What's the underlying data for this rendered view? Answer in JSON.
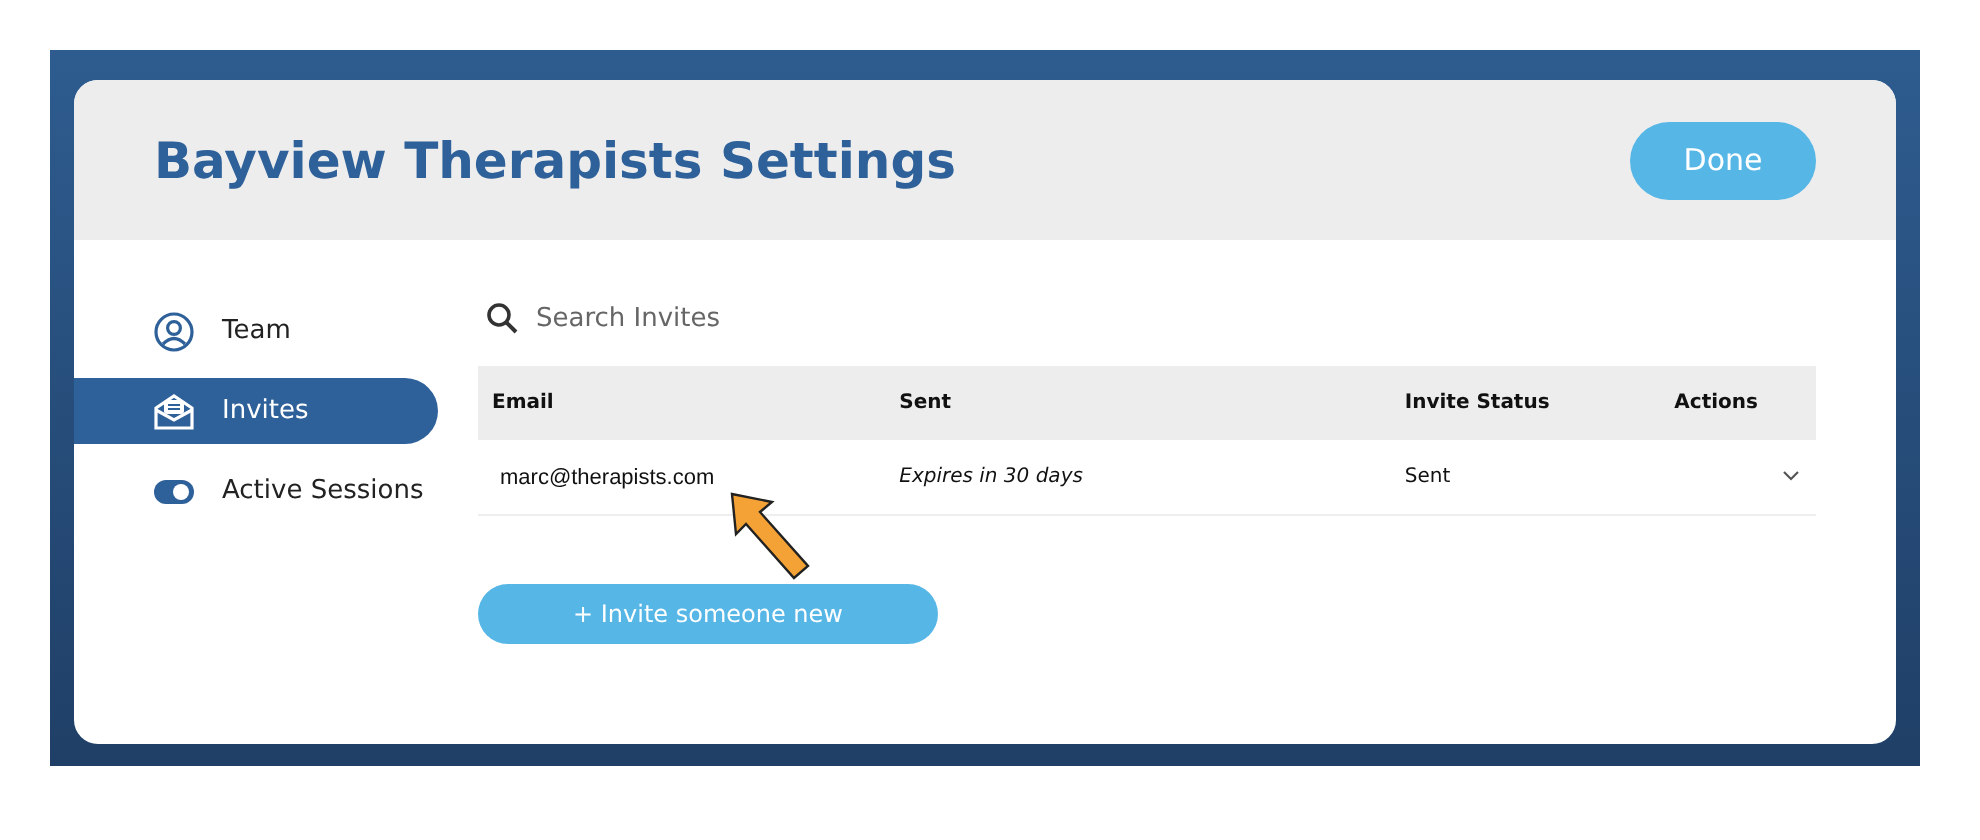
{
  "window": {
    "title": "Bayview Therapists Settings",
    "done_button": "Done"
  },
  "sidebar": {
    "items": [
      {
        "label": "Team",
        "kind": "person",
        "selected": false
      },
      {
        "label": "Invites",
        "kind": "envelope",
        "selected": true
      },
      {
        "label": "Active Sessions",
        "kind": "toggle",
        "selected": false
      }
    ]
  },
  "search": {
    "placeholder": "Search Invites"
  },
  "table": {
    "columns": [
      "Email",
      "Sent",
      "Invite Status",
      "Actions"
    ],
    "rows": [
      {
        "email": "marc@therapists.com",
        "sent": "Expires in 30 days",
        "status": "Sent"
      }
    ]
  },
  "invite_button": "+ Invite someone new"
}
